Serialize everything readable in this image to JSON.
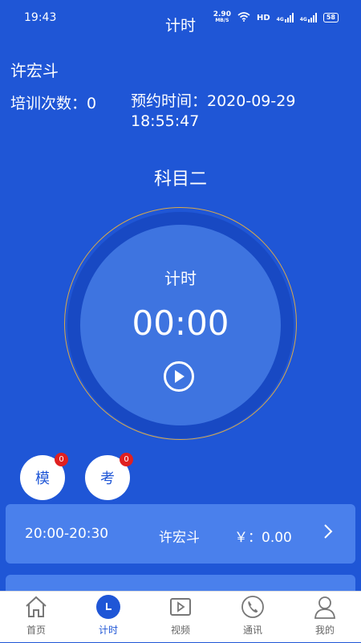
{
  "status_bar": {
    "time": "19:43",
    "net_speed_value": "2.90",
    "net_speed_unit": "MB/S",
    "hd_label": "HD",
    "net_a": "4G",
    "net_b": "4G",
    "battery": "58"
  },
  "nav": {
    "title": "计时"
  },
  "user": {
    "name": "许宏斗",
    "train_count": "培训次数：0",
    "appointment_line1": "预约时间：2020-09-29",
    "appointment_line2": "18:55:47"
  },
  "subject": "科目二",
  "timer": {
    "label": "计时",
    "value": "00:00"
  },
  "buttons": {
    "mock": {
      "label": "模",
      "badge": "0"
    },
    "exam": {
      "label": "考",
      "badge": "0"
    }
  },
  "records": [
    {
      "time": "20:00-20:30",
      "name": "许宏斗",
      "price": "￥：0.00"
    }
  ],
  "tabs": [
    {
      "label": "首页",
      "icon": "home-icon"
    },
    {
      "label": "计时",
      "icon": "clock-icon"
    },
    {
      "label": "视频",
      "icon": "video-icon"
    },
    {
      "label": "通讯",
      "icon": "phone-icon"
    },
    {
      "label": "我的",
      "icon": "person-icon"
    }
  ],
  "colors": {
    "background": "#1f56d6",
    "card": "#4a80ec",
    "ring": "#d9a94a",
    "badge": "#e02020",
    "active_tab": "#1f56d6"
  }
}
